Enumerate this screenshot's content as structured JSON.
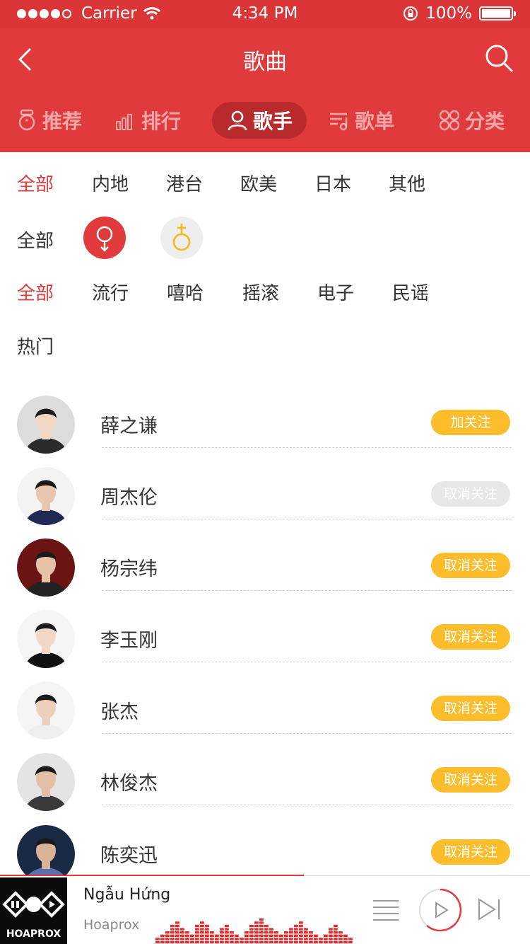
{
  "status": {
    "carrier": "Carrier",
    "time": "4:34 PM",
    "battery": "100%"
  },
  "nav": {
    "title": "歌曲"
  },
  "tabs": [
    {
      "label": "推荐",
      "icon": "medal-icon"
    },
    {
      "label": "排行",
      "icon": "bar-chart-icon"
    },
    {
      "label": "歌手",
      "icon": "person-icon",
      "active": true
    },
    {
      "label": "歌单",
      "icon": "playlist-icon"
    },
    {
      "label": "分类",
      "icon": "category-icon"
    }
  ],
  "region_filters": [
    "全部",
    "内地",
    "港台",
    "欧美",
    "日本",
    "其他"
  ],
  "gender_filters": {
    "label": "全部",
    "female_icon": "female-icon",
    "male_icon": "male-icon"
  },
  "genre_filters": [
    "全部",
    "流行",
    "嘻哈",
    "摇滚",
    "电子",
    "民谣"
  ],
  "section_title": "热门",
  "singers": [
    {
      "name": "薛之谦",
      "button": "加关注",
      "state": "follow"
    },
    {
      "name": "周杰伦",
      "button": "取消关注",
      "state": "disabled"
    },
    {
      "name": "杨宗纬",
      "button": "取消关注",
      "state": "unfollow"
    },
    {
      "name": "李玉刚",
      "button": "取消关注",
      "state": "unfollow"
    },
    {
      "name": "张杰",
      "button": "取消关注",
      "state": "unfollow"
    },
    {
      "name": "林俊杰",
      "button": "取消关注",
      "state": "unfollow"
    },
    {
      "name": "陈奕迅",
      "button": "取消关注",
      "state": "unfollow"
    }
  ],
  "player": {
    "track": "Ngẫu Hứng",
    "artist": "Hoaprox",
    "cover_text": "HOAPROX"
  },
  "colors": {
    "primary": "#e03a3c",
    "accent": "#fbbd2b"
  }
}
